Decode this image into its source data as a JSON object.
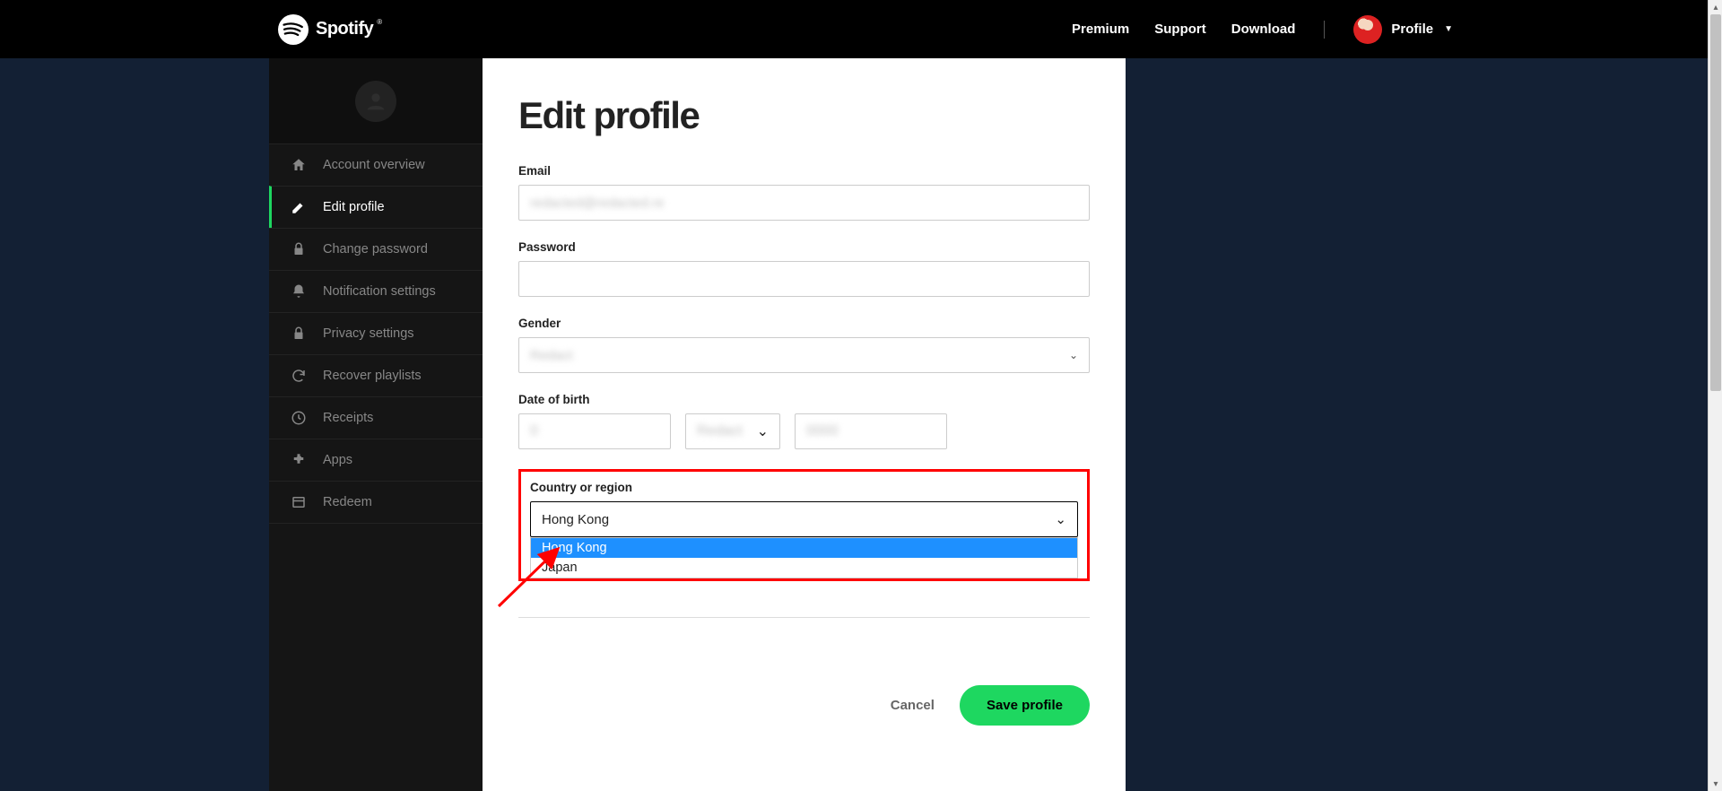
{
  "header": {
    "brand": "Spotify",
    "nav": {
      "premium": "Premium",
      "support": "Support",
      "download": "Download",
      "profile": "Profile"
    }
  },
  "sidebar": {
    "items": [
      {
        "label": "Account overview",
        "icon": "home-icon"
      },
      {
        "label": "Edit profile",
        "icon": "pen-icon"
      },
      {
        "label": "Change password",
        "icon": "lock-icon"
      },
      {
        "label": "Notification settings",
        "icon": "bell-icon"
      },
      {
        "label": "Privacy settings",
        "icon": "lock-icon"
      },
      {
        "label": "Recover playlists",
        "icon": "refresh-icon"
      },
      {
        "label": "Receipts",
        "icon": "clock-icon"
      },
      {
        "label": "Apps",
        "icon": "puzzle-icon"
      },
      {
        "label": "Redeem",
        "icon": "card-icon"
      }
    ]
  },
  "main": {
    "title": "Edit profile",
    "labels": {
      "email": "Email",
      "password": "Password",
      "gender": "Gender",
      "dob": "Date of birth",
      "country": "Country or region"
    },
    "values": {
      "email": "redacted@redacted.re",
      "gender": "Redact",
      "dob_day": "0",
      "dob_month": "Redact",
      "dob_year": "0000",
      "country_selected": "Hong Kong"
    },
    "country_options": [
      "Hong Kong",
      "Japan"
    ],
    "buttons": {
      "cancel": "Cancel",
      "save": "Save profile"
    }
  }
}
